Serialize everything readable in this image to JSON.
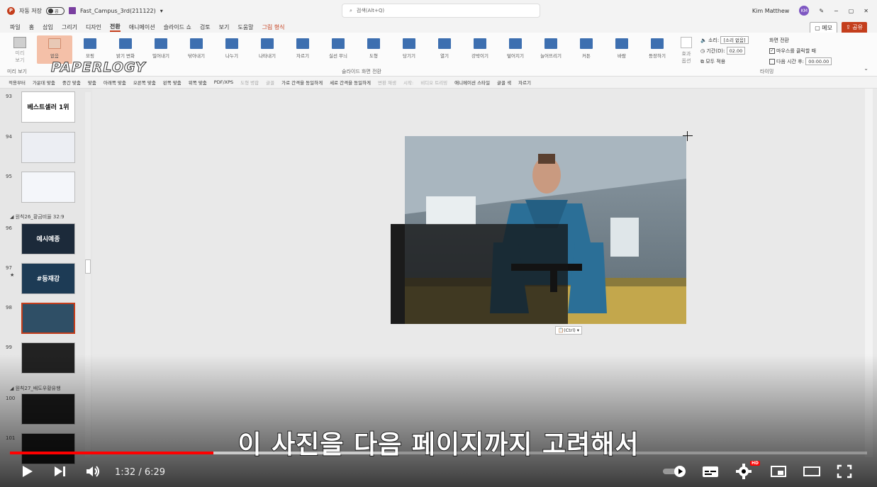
{
  "title_bar": {
    "autosave_label": "자동 저장",
    "autosave_state": "끔",
    "file_name": "Fast_Campus_3rd(211122)",
    "search_placeholder": "검색(Alt+Q)",
    "user_name": "Kim Matthew",
    "user_initials": "KM"
  },
  "ribbon_tabs": [
    "파일",
    "홈",
    "삽입",
    "그리기",
    "디자인",
    "전환",
    "애니메이션",
    "슬라이드 쇼",
    "검토",
    "보기",
    "도움말",
    "그림 형식"
  ],
  "active_tab": "전환",
  "memo_label": "메모",
  "share_label": "공유",
  "watermark": "PAPERLOGY",
  "preview": {
    "label_line1": "미리",
    "label_line2": "보기",
    "group": "미리 보기"
  },
  "transitions": [
    "없음",
    "모핑",
    "밝기 변화",
    "밀어내기",
    "닦아내기",
    "나누기",
    "나타내기",
    "자르기",
    "실선 무늬",
    "도형",
    "당기기",
    "열기",
    "강박이기",
    "덮어지기",
    "늘어뜨리기",
    "커튼",
    "바람",
    "등장하기"
  ],
  "selected_transition": "없음",
  "transition_group_label": "슬라이드 화면 전환",
  "effect_options": {
    "label1": "효과",
    "label2": "옵션"
  },
  "timing": {
    "sound_label": "소리:",
    "sound_value": "[소리 없음]",
    "duration_label": "기간(D):",
    "duration_value": "02.00",
    "apply_all": "모두 적용",
    "advance_header": "화면 전환",
    "on_click": "마우스를 클릭할 때",
    "after_label": "다음 시간 후:",
    "after_value": "00:00.00",
    "group": "타이밍"
  },
  "quick_access": [
    "적용부터",
    "가운데 맞춤",
    "중간 맞춤",
    "맞춤",
    "아래쪽 맞춤",
    "오른쪽 맞춤",
    "왼쪽 맞춤",
    "위쪽 맞춤",
    "PDF/XPS",
    "도형 병합",
    "글꼴",
    "가로 간격을 동일하게",
    "세로 간격을 동일하게",
    "변환 재생",
    "시작:",
    "비디오 트리밍",
    "애니메이션 스타일",
    "글꼴 색",
    "자르기"
  ],
  "slides": [
    {
      "num": "93",
      "title": "베스트셀러 1위"
    },
    {
      "num": "94",
      "title": ""
    },
    {
      "num": "95",
      "title": ""
    },
    {
      "num": "96",
      "title": "예시예종"
    },
    {
      "num": "97",
      "title": "#등재강",
      "star": "★"
    },
    {
      "num": "98",
      "title": ""
    },
    {
      "num": "99",
      "title": ""
    },
    {
      "num": "100",
      "title": ""
    },
    {
      "num": "101",
      "title": ""
    }
  ],
  "sections": [
    "원칙26_황금비율 32:9",
    "원칙27_배도우황유행"
  ],
  "paste_tag": "(Ctrl)",
  "subtitle": "이 사진을 다음 페이지까지 고려해서",
  "video": {
    "current_time": "1:32",
    "duration": "6:29",
    "time_text": "1:32 / 6:29",
    "progress_fraction": 0.237,
    "buffered_fraction": 0.45,
    "hd": "HD"
  },
  "colors": {
    "accent": "#c43e1c",
    "progress": "#ff0000"
  }
}
